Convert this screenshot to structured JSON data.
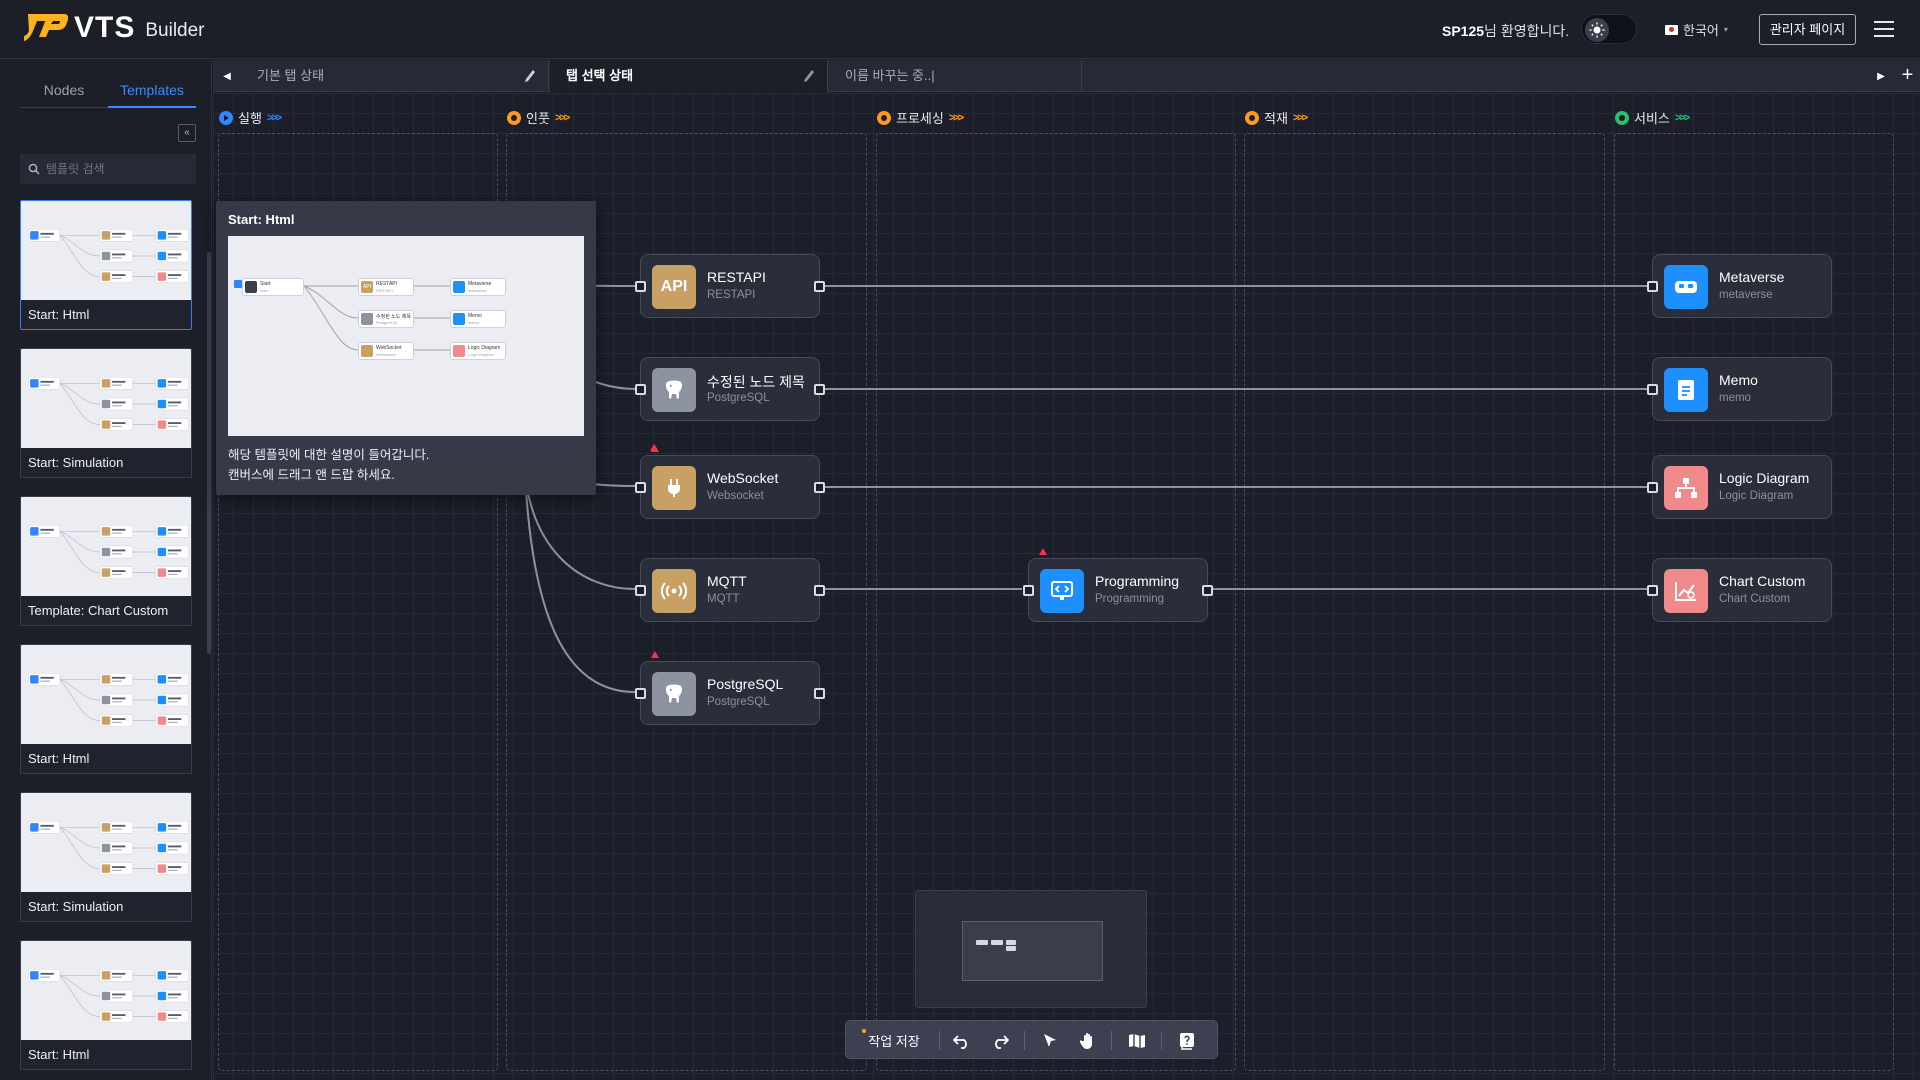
{
  "header": {
    "logo_text": "VTS",
    "logo_sub": "Builder",
    "welcome_user": "SP125",
    "welcome_suffix": "님 환영합니다.",
    "language": "한국어",
    "admin_button": "관리자 페이지"
  },
  "sidebar": {
    "tabs": [
      "Nodes",
      "Templates"
    ],
    "active_tab": "Templates",
    "collapse_label": "«",
    "search_placeholder": "템플릿 검색",
    "templates": [
      "Start: Html",
      "Start: Simulation",
      "Template: Chart Custom",
      "Start: Html",
      "Start: Simulation",
      "Start: Html"
    ],
    "selected_index": 0
  },
  "tabs": [
    {
      "label": "기본 탭 상태",
      "active": false
    },
    {
      "label": "탭 선택 상태",
      "active": true
    },
    {
      "label": "이름 바꾸는 중..|",
      "active": false
    }
  ],
  "lanes": [
    {
      "label": "실행",
      "color": "#3b8bff"
    },
    {
      "label": "인풋",
      "color": "#ff9a1f"
    },
    {
      "label": "프로세싱",
      "color": "#ff9a1f"
    },
    {
      "label": "적재",
      "color": "#ff9a1f"
    },
    {
      "label": "서비스",
      "color": "#27c06b"
    }
  ],
  "lane_chevrons": ">>>",
  "nodes": {
    "restapi": {
      "title": "RESTAPI",
      "sub": "RESTAPI",
      "icon_text": "API"
    },
    "postgres_renamed": {
      "title": "수정된 노드 제목",
      "sub": "PostgreSQL"
    },
    "websocket": {
      "title": "WebSocket",
      "sub": "Websocket"
    },
    "mqtt": {
      "title": "MQTT",
      "sub": "MQTT"
    },
    "postgres": {
      "title": "PostgreSQL",
      "sub": "PostgreSQL"
    },
    "programming": {
      "title": "Programming",
      "sub": "Programming"
    },
    "metaverse": {
      "title": "Metaverse",
      "sub": "metaverse"
    },
    "memo": {
      "title": "Memo",
      "sub": "memo"
    },
    "logic": {
      "title": "Logic Diagram",
      "sub": "Logic Diagram"
    },
    "chart": {
      "title": "Chart Custom",
      "sub": "Chart Custom"
    }
  },
  "colors": {
    "input_icon": "#c9a064",
    "postgres_icon": "#8d92a0",
    "programming_icon": "#1e8fff",
    "service_blue": "#1e8fff",
    "service_pink": "#f08a8a"
  },
  "toolbar": {
    "save_label": "작업 저장"
  },
  "tooltip": {
    "title": "Start: Html",
    "desc_line1": "해당 템플릿에 대한 설명이 들어갑니다.",
    "desc_line2": "캔버스에 드래그 앤 드랍 하세요."
  },
  "preview": {
    "start": {
      "title": "Start",
      "sub": "start"
    },
    "restapi": {
      "title": "RESTAPI",
      "sub": "RESTAPI",
      "icon_text": "API"
    },
    "postgres": {
      "title": "수정된 노드 제목",
      "sub": "PostgreSQL"
    },
    "websocket": {
      "title": "WebSocket",
      "sub": "Websocket"
    },
    "metaverse": {
      "title": "Metaverse",
      "sub": "metaverse"
    },
    "memo": {
      "title": "Memo",
      "sub": "memo"
    },
    "logic": {
      "title": "Logic Diagram",
      "sub": "Logic Diagram"
    }
  }
}
